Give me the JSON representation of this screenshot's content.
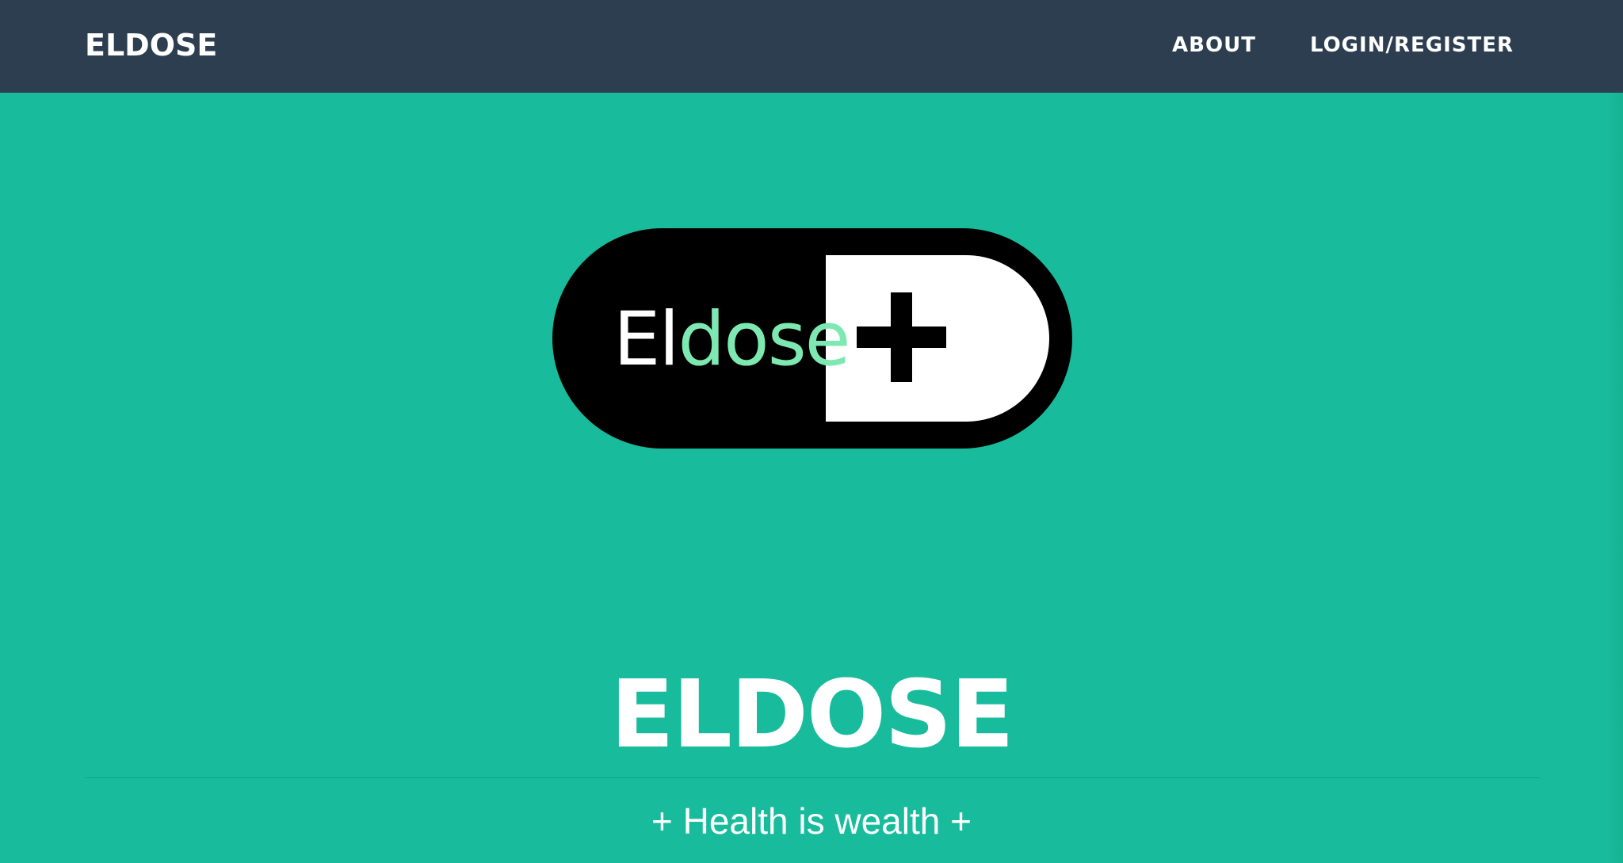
{
  "colors": {
    "navbar_bg": "#2c3e50",
    "masthead_bg": "#18bc9c",
    "text": "#ffffff",
    "logo_dark": "#000000",
    "logo_accent": "#7ee8b2"
  },
  "navbar": {
    "brand": "ELDOSE",
    "links": [
      {
        "label": "ABOUT"
      },
      {
        "label": "LOGIN/REGISTER"
      }
    ]
  },
  "logo": {
    "text_part1": "El",
    "text_part2": "dose",
    "icon": "plus-icon"
  },
  "hero": {
    "title": "ELDOSE",
    "tagline": "+ Health is wealth +"
  }
}
